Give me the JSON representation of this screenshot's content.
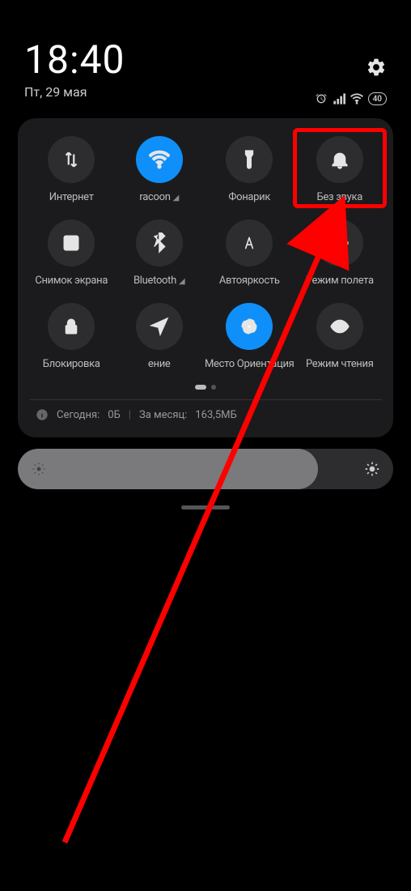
{
  "header": {
    "time": "18:40",
    "date": "Пт, 29 мая",
    "battery": "40"
  },
  "tiles": [
    {
      "label": "Интернет",
      "icon": "data-arrows",
      "active": false
    },
    {
      "label": "racoon",
      "icon": "wifi",
      "active": true,
      "signal": true
    },
    {
      "label": "Фонарик",
      "icon": "flashlight",
      "active": false
    },
    {
      "label": "Без звука",
      "icon": "bell",
      "active": false,
      "highlighted": true
    },
    {
      "label": "Снимок экрана",
      "icon": "screenshot",
      "active": false
    },
    {
      "label": "Bluetooth",
      "icon": "bluetooth",
      "active": false,
      "signal": true
    },
    {
      "label": "Автояркость",
      "icon": "auto-brightness",
      "active": false
    },
    {
      "label": "Режим полета",
      "icon": "airplane",
      "active": false
    },
    {
      "label": "Блокировка",
      "icon": "lock",
      "active": false
    },
    {
      "label": "ение",
      "icon": "location",
      "active": false
    },
    {
      "label": "Место    Ориентация",
      "icon": "rotation",
      "active": true
    },
    {
      "label": "Режим чтения",
      "icon": "eye",
      "active": false
    }
  ],
  "data_usage": {
    "today_label": "Сегодня:",
    "today_value": "0Б",
    "month_label": "За месяц:",
    "month_value": "163,5МБ"
  }
}
